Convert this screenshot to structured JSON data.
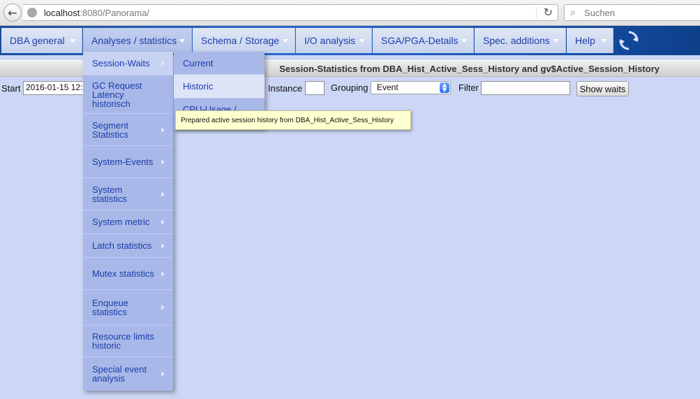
{
  "browser": {
    "url_host": "localhost",
    "url_rest": ":8080/Panorama/",
    "search_placeholder": "Suchen"
  },
  "menubar": {
    "items": [
      {
        "label": "DBA general"
      },
      {
        "label": "Analyses / statistics"
      },
      {
        "label": "Schema / Storage"
      },
      {
        "label": "I/O analysis"
      },
      {
        "label": "SGA/PGA-Details"
      },
      {
        "label": "Spec. additions"
      },
      {
        "label": "Help"
      }
    ]
  },
  "page_title": "Session-Statistics from DBA_Hist_Active_Sess_History and gv$Active_Session_History",
  "form": {
    "start_label": "Start",
    "start_value": "2016-01-15 12:",
    "instance_label": "Instance",
    "instance_value": "",
    "grouping_label": "Grouping",
    "grouping_value": "Event",
    "filter_label": "Filter",
    "filter_value": "",
    "show_waits_label": "Show waits"
  },
  "dropdown": {
    "items": [
      {
        "label": "Session-Waits",
        "has_sub": true
      },
      {
        "label": "GC Request Latency historisch",
        "has_sub": false
      },
      {
        "label": "Segment Statistics",
        "has_sub": true
      },
      {
        "label": "System-Events",
        "has_sub": true
      },
      {
        "label": "System statistics",
        "has_sub": true
      },
      {
        "label": "System metric",
        "has_sub": true
      },
      {
        "label": "Latch statistics",
        "has_sub": true
      },
      {
        "label": "Mutex statistics",
        "has_sub": true
      },
      {
        "label": "Enqueue statistics",
        "has_sub": true
      },
      {
        "label": "Resource limits historic",
        "has_sub": false
      },
      {
        "label": "Special event analysis",
        "has_sub": true
      }
    ]
  },
  "submenu": {
    "items": [
      {
        "label": "Current"
      },
      {
        "label": "Historic"
      },
      {
        "label": "CPU-Usage / ..."
      }
    ]
  },
  "tooltip": "Prepared active session history from DBA_Hist_Active_Sess_History",
  "colors": {
    "accent": "#1c3ca8",
    "page_background": "#ccd7f5",
    "menubar": "#2a6ac8"
  }
}
